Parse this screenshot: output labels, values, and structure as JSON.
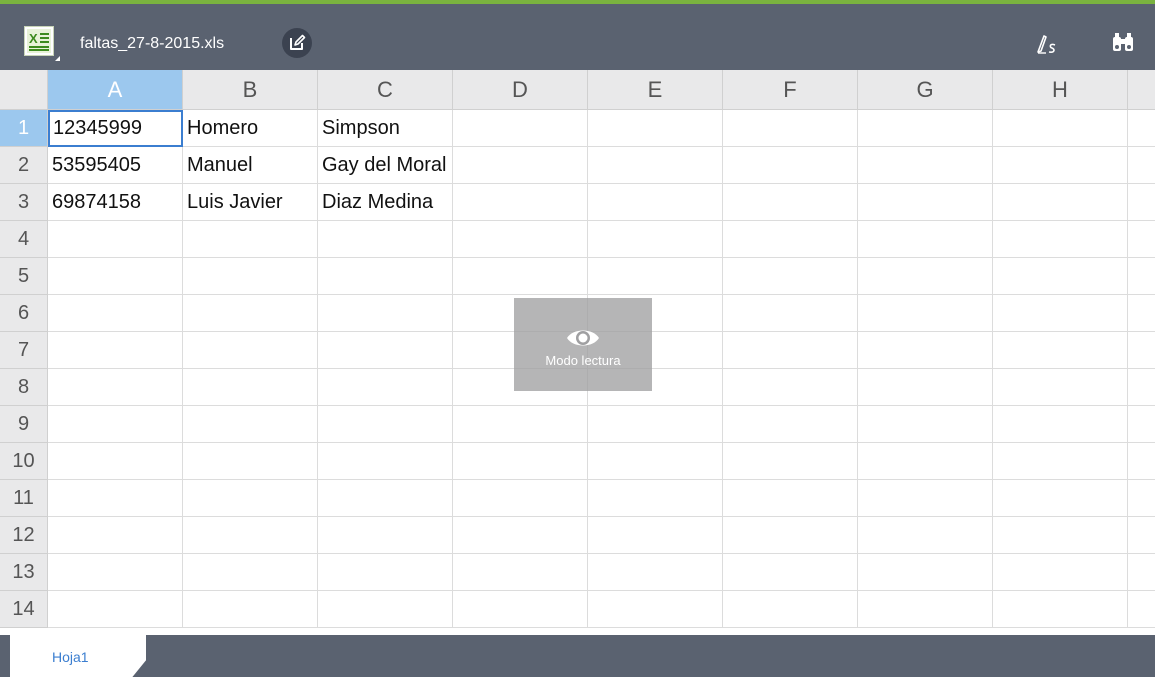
{
  "toolbar": {
    "filename": "faltas_27-8-2015.xls",
    "app_icon": "excel-file-icon",
    "edit_icon": "edit-icon",
    "pen_icon": "pen-icon",
    "find_icon": "binoculars-icon",
    "accent_color": "#7ab33f",
    "bar_color": "#5a6270"
  },
  "grid": {
    "columns": [
      "A",
      "B",
      "C",
      "D",
      "E",
      "F",
      "G",
      "H"
    ],
    "rows": [
      "1",
      "2",
      "3",
      "4",
      "5",
      "6",
      "7",
      "8",
      "9",
      "10",
      "11",
      "12",
      "13",
      "14"
    ],
    "selected_column": "A",
    "selected_row": "1",
    "active_cell": "A1",
    "cells": [
      [
        "12345999",
        "Homero",
        "Simpson",
        "",
        "",
        "",
        "",
        ""
      ],
      [
        "53595405",
        "Manuel",
        "Gay del Moral",
        "",
        "",
        "",
        "",
        ""
      ],
      [
        "69874158",
        "Luis Javier",
        "Diaz Medina",
        "",
        "",
        "",
        "",
        ""
      ]
    ],
    "selection_color": "#9cc8ee"
  },
  "reading_mode": {
    "icon": "eye-icon",
    "label": "Modo lectura"
  },
  "sheets": {
    "tabs": [
      "Hoja1"
    ],
    "active_tab": "Hoja1"
  }
}
